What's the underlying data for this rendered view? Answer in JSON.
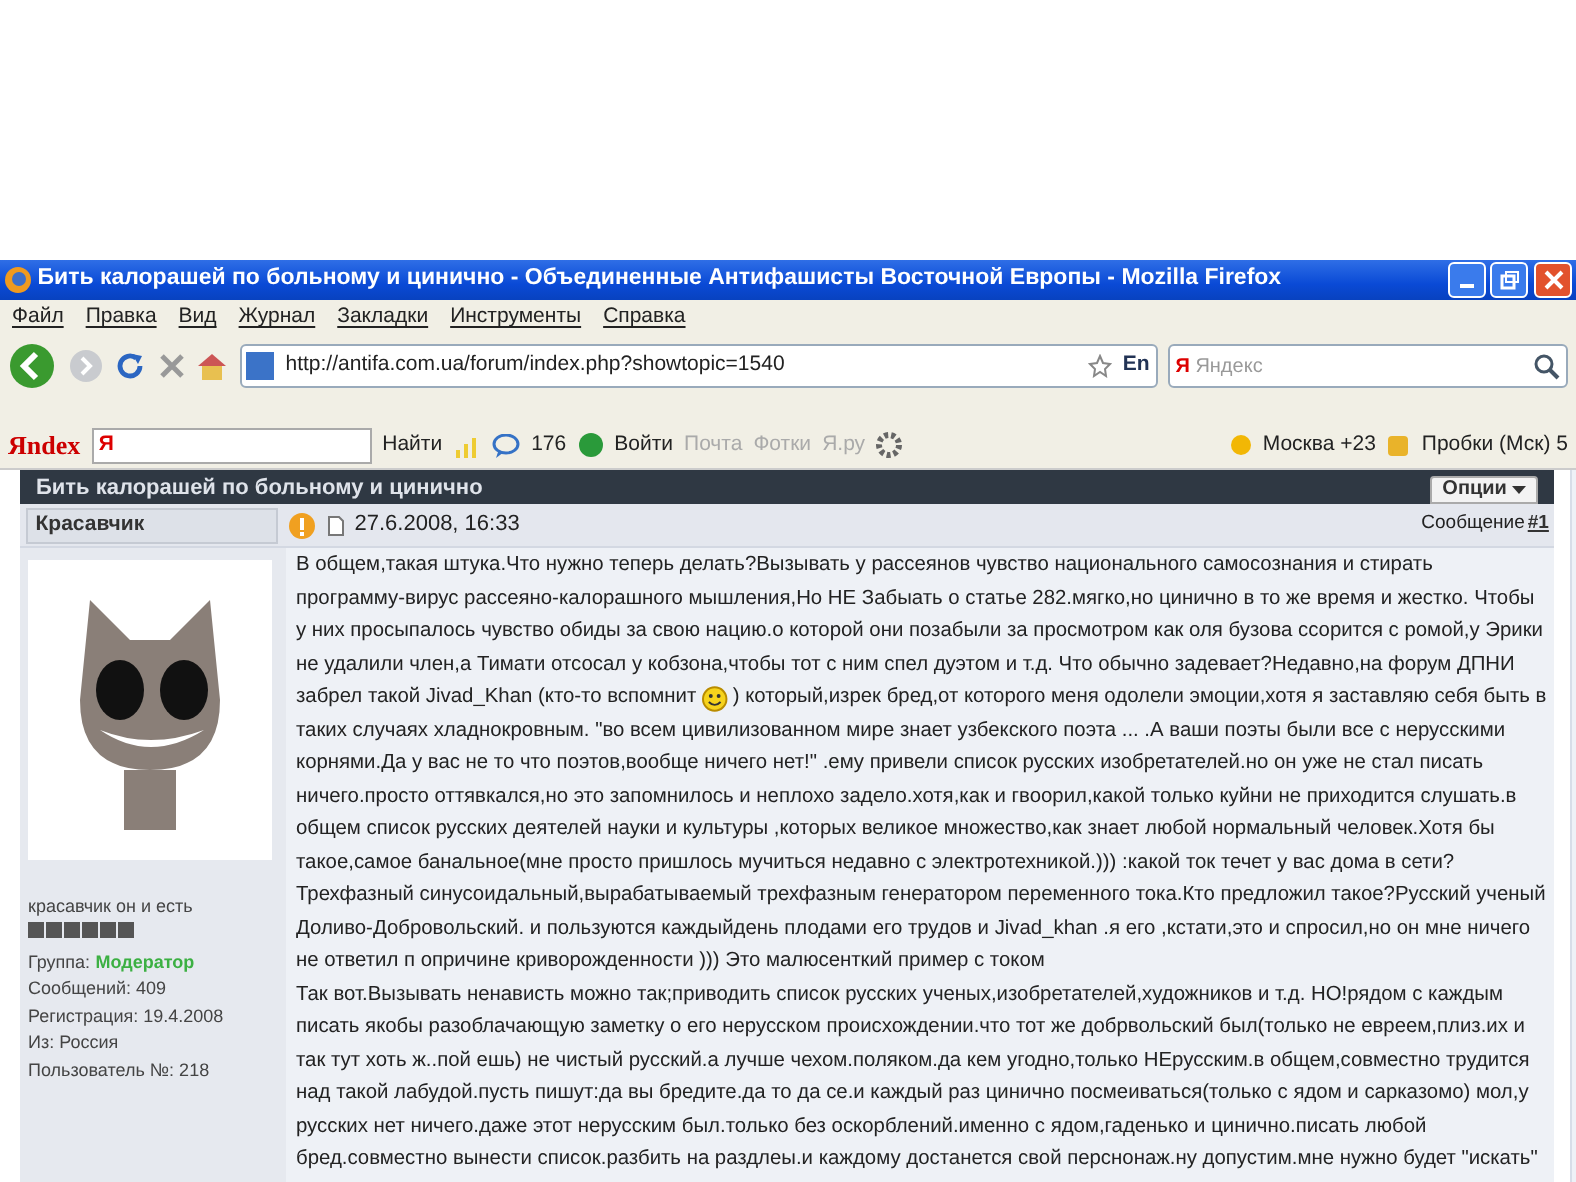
{
  "window": {
    "title": "Бить калорашей по больному и цинично - Объединенные Антифашисты Восточной Европы - Mozilla Firefox"
  },
  "menu": [
    "Файл",
    "Правка",
    "Вид",
    "Журнал",
    "Закладки",
    "Инструменты",
    "Справка"
  ],
  "navbar": {
    "url": "http://antifa.com.ua/forum/index.php?showtopic=1540",
    "language": "En",
    "search_logo": "Я",
    "search_placeholder": "Яндекс"
  },
  "yandex_bar": {
    "logo": "Яndex",
    "search_logo": "Я",
    "find": "Найти",
    "comments": "176",
    "login": "Войти",
    "items": [
      {
        "label": "Почта",
        "disabled": true
      },
      {
        "label": "Фотки",
        "disabled": true
      },
      {
        "label": "Я.ру",
        "disabled": true
      }
    ],
    "weather": "Москва +23",
    "traffic": "Пробки (Мск) 5"
  },
  "topic": {
    "title": "Бить калорашей по больному и цинично",
    "options": "Опции"
  },
  "post": {
    "author": "Красавчик",
    "date": "27.6.2008, 16:33",
    "number_label": "Сообщение",
    "number": "#1",
    "status": "красавчик он и есть",
    "group_label": "Группа:",
    "group": "Модератор",
    "info": [
      "Сообщений: 409",
      "Регистрация: 19.4.2008",
      "Из: Россия",
      "Пользователь №: 218"
    ],
    "paragraphs": [
      [
        [
          {
            "kind": "text",
            "text": "В общем,такая штука.Что нужно теперь делать?Вызывать у рассеянов чувство национального самосознания и стирать программу-вирус рассеяно-калорашного мышления,Но НЕ Забыать о статье 282.мягко,но цинично в то же время и жестко. Чтобы у них просыпалось чувство обиды за свою нацию.о которой они позабыли за просмотром как оля бузова ссорится с ромой,у Эрики не удалили член,а Тимати отсосал у кобзона,чтобы тот с ним спел дуэтом и т.д. Что обычно задевает?Недавно,на форум ДПНИ"
          }
        ],
        [
          {
            "kind": "text",
            "text": "забрел такой Jivad_Khan (кто-то вспомнит"
          },
          {
            "kind": "smiley"
          },
          {
            "kind": "text",
            "text": ") который,изрек бред,от которого меня одолели эмоции,хотя я заставляю себя быть в"
          }
        ],
        [
          {
            "kind": "text",
            "text": "таких случаях хладнокровным. \"во всем цивилизованном мире знает узбекского поэта ... .А ваши поэты были все с нерусскими корнями.Да у вас не то что поэтов,вообще ничего нет!\" .ему привели список русских изобретателей.но он уже не стал писать ничего.просто оттявкался,но это запомнилось и неплохо задело.хотя,как и гвоорил,какой только куйни не приходится слушать.в общем список русских деятелей науки и культуры ,которых великое множество,как знает любой нормальный человек.Хотя бы такое,самое банальное(мне просто пришлось мучиться недавно с электротехникой.))) :какой ток течет у вас дома в сети?Трехфазный синусоидальный,вырабатываемый трехфазным генератором переменного тока.Кто предложил такое?Русский ученый Доливо-Добровольский. и пользуются каждыйдень плодами его трудов и Jivad_khan .я его ,кстати,это и спросил,но он мне ничего не ответил п опричине криворожденности ))) Это малюсенткий пример с током"
          }
        ]
      ],
      [
        [
          {
            "kind": "text",
            "text": "Так вот.Вызывать ненависть можно так;приводить список русских ученых,изобретателей,художников и т.д. НО!рядом с каждым писать якобы разоблачающую заметку о его нерусском происхождении.что тот же добрвольский был(только не евреем,плиз.их и так тут хоть ж..пой ешь) не чистый русский.а лучше чехом.поляком.да кем угодно,только НЕрусским.в общем,совместно трудится над такой лабудой.пусть пишут:да вы бредите.да то да се.и каждый раз цинично посмеиваться(только с ядом и сарказомо) мол,у русских нет ничего.даже этот нерусским был.только без оскорблений.именно с ядом,гаденько и цинично.писать любой бред.совместно вынести список.разбить на раздлеы.и каждому достанется свой перснонаж.ну допустим.мне нужно будет \"искать\""
          }
        ]
      ]
    ]
  }
}
